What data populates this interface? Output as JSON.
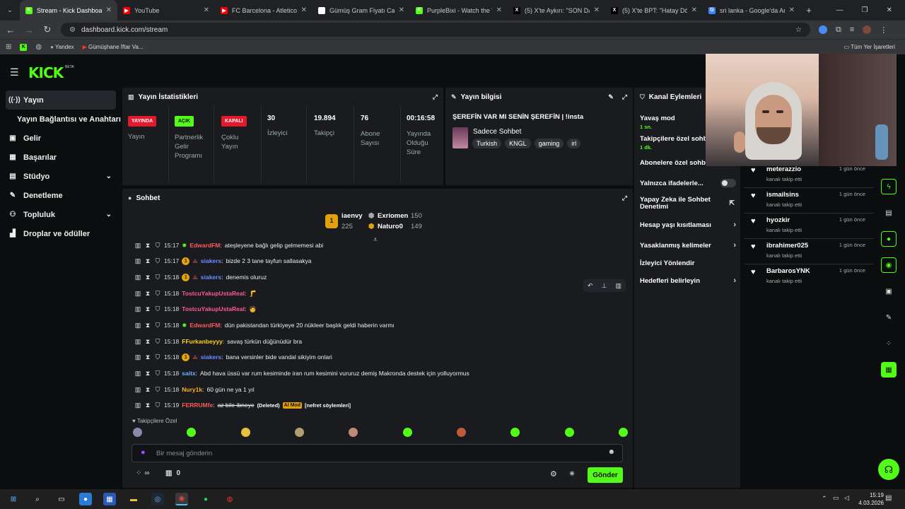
{
  "browser": {
    "tabs": [
      {
        "title": "Stream - Kick Dashboard",
        "favicon": "K",
        "color": "#53fc18",
        "active": true
      },
      {
        "title": "YouTube",
        "favicon": "▶",
        "color": "#ff0000",
        "active": false
      },
      {
        "title": "FC Barcelona - Atletico M",
        "favicon": "▶",
        "color": "#ff0000",
        "active": false
      },
      {
        "title": "Gümüş Gram Fiyatı Canlı",
        "favicon": "b",
        "color": "#ffffff",
        "active": false
      },
      {
        "title": "PurpleBixi - Watch the VO",
        "favicon": "K",
        "color": "#53fc18",
        "active": false
      },
      {
        "title": "(5) X'te Aykırı: \"SON DAKİ",
        "favicon": "X",
        "color": "#000000",
        "active": false
      },
      {
        "title": "(5) X'te BPT: \"Hatay Dörty",
        "favicon": "X",
        "color": "#000000",
        "active": false
      },
      {
        "title": "sri lanka - Google'da Ara",
        "favicon": "G",
        "color": "#4285f4",
        "active": false
      }
    ],
    "url": "dashboard.kick.com/stream",
    "bookmarks": [
      "Yandex",
      "Gümüşhane İftar Va..."
    ],
    "all_bookmarks": "Tüm Yer İşaretleri"
  },
  "brand": {
    "logo": "KICK",
    "beta": "BETA",
    "accent": "#53fc18"
  },
  "sidebar": {
    "items": [
      {
        "label": "Yayın",
        "icon": "broadcast-icon",
        "glyph": "((·))"
      },
      {
        "label": "Yayın Bağlantısı ve Anahtarı",
        "icon": "",
        "glyph": ""
      },
      {
        "label": "Gelir",
        "icon": "revenue-icon",
        "glyph": "▣"
      },
      {
        "label": "Başarılar",
        "icon": "achievements-icon",
        "glyph": "▦"
      },
      {
        "label": "Stüdyo",
        "icon": "studio-icon",
        "glyph": "▤"
      },
      {
        "label": "Denetleme",
        "icon": "moderation-icon",
        "glyph": "✎"
      },
      {
        "label": "Topluluk",
        "icon": "community-icon",
        "glyph": "👥"
      },
      {
        "label": "Droplar ve ödüller",
        "icon": "drops-icon",
        "glyph": "▟"
      }
    ]
  },
  "stats": {
    "title": "Yayın İstatistikleri",
    "live_badge": "YAYINDA",
    "live_label": "Yayın",
    "partner_badge": "AÇIK",
    "partner_label": "Partnerlik Gelir Programı",
    "multistream_badge": "KAPALI",
    "multistream_label": "Çoklu Yayın",
    "viewers": "30",
    "viewers_label": "İzleyici",
    "followers": "19.894",
    "followers_label": "Takipçi",
    "subs": "76",
    "subs_label": "Abone Sayısı",
    "uptime": "00:16:58",
    "uptime_label": "Yayında Olduğu Süre"
  },
  "stream_info": {
    "title": "Yayın bilgisi",
    "stream_title": "ŞEREFİN VAR MI SENİN ŞEREFİN | !insta",
    "category": "Sadece Sohbet",
    "tags": [
      "Turkish",
      "KNGL",
      "gaming",
      "irl"
    ]
  },
  "channel_actions": {
    "title": "Kanal Eylemleri",
    "items": [
      {
        "label": "Yavaş mod",
        "sub": "1 sn."
      },
      {
        "label": "Takipçilere özel sohbet",
        "sub": "1 dk."
      },
      {
        "label": "Abonelere özel sohbet",
        "sub": ""
      },
      {
        "label": "Yalnızca ifadelerle...",
        "sub": ""
      },
      {
        "label": "Yapay Zeka ile Sohbet Denetimi",
        "sub": ""
      },
      {
        "label": "Hesap yaşı kısıtlaması",
        "sub": ""
      },
      {
        "label": "Yasaklanmış kelimeler",
        "sub": ""
      },
      {
        "label": "İzleyici Yönlendir",
        "sub": ""
      },
      {
        "label": "Hedefleri belirleyin",
        "sub": ""
      }
    ]
  },
  "followers_feed": [
    {
      "name": "meterazzio",
      "action": "kanalı takip etti",
      "time": "1 gün önce"
    },
    {
      "name": "ismailsins",
      "action": "kanalı takip etti",
      "time": "1 gün önce"
    },
    {
      "name": "hyozkir",
      "action": "kanalı takip etti",
      "time": "1 gün önce"
    },
    {
      "name": "ibrahimer025",
      "action": "kanalı takip etti",
      "time": "1 gün önce"
    },
    {
      "name": "BarbarosYNK",
      "action": "kanalı takip etti",
      "time": "1 gün önce"
    }
  ],
  "chat": {
    "title": "Sohbet",
    "leaderboard": {
      "first": {
        "rank": "1",
        "name": "iaenvy",
        "score": "225"
      },
      "second": {
        "name": "Exriomen",
        "score": "150"
      },
      "third": {
        "name": "Naturo0",
        "score": "149"
      }
    },
    "messages": [
      {
        "time": "15:17",
        "user": "EdwardFM",
        "color": "#ff5a5a",
        "text": "ateşleyene bağlı gelip gelmemesi abi",
        "badge": "verified"
      },
      {
        "time": "15:17",
        "user": "siakers",
        "color": "#6c8cff",
        "text": "bizde 2 3 tane tayfun sallasakya",
        "badge": "coin"
      },
      {
        "time": "15:18",
        "user": "siakers",
        "color": "#6c8cff",
        "text": "denemis oluruz",
        "badge": "coin"
      },
      {
        "time": "15:18",
        "user": "TostcuYakupUstaReal",
        "color": "#ff5a8a",
        "text": "🦵",
        "badge": ""
      },
      {
        "time": "15:18",
        "user": "TostcuYakupUstaReal",
        "color": "#ff5a8a",
        "text": "🧑",
        "badge": ""
      },
      {
        "time": "15:18",
        "user": "EdwardFM",
        "color": "#ff5a5a",
        "text": "dün pakistandan türkiyeye 20 nükleer başlık geldi haberin varmı",
        "badge": "verified"
      },
      {
        "time": "15:18",
        "user": "FFurkanbeyyy",
        "color": "#ffd21a",
        "text": "savaş türkün düğünüdür bra",
        "badge": ""
      },
      {
        "time": "15:18",
        "user": "siakers",
        "color": "#6c8cff",
        "text": "bana versinler bide vandal sikiyim onlari",
        "badge": "coin"
      },
      {
        "time": "15:18",
        "user": "saitx",
        "color": "#6ab0ff",
        "text": "Abd hava üssü var rum kesiminde iran rum kesimini vururuz demiş Makronda destek için yolluyormus",
        "badge": ""
      },
      {
        "time": "15:18",
        "user": "Nury1k",
        "color": "#ffb020",
        "text": "60 gün ne ya 1 yıl",
        "badge": ""
      },
      {
        "time": "15:19",
        "user": "FERRUMfe",
        "color": "#ff5a5a",
        "text": "az bile ibneye",
        "badge": "deleted"
      }
    ],
    "deleted_label": "(Deleted)",
    "ai_mod_label": "AI Mod",
    "ai_mod_reason": "[nefret söylemleri]",
    "followers_only": "Takipçilere Özel",
    "input_placeholder": "Bir mesaj gönderin",
    "infinity": "∞",
    "points": "0",
    "send_label": "Gönder"
  },
  "taskbar": {
    "time": "15:19",
    "date": "4.03.2026"
  }
}
